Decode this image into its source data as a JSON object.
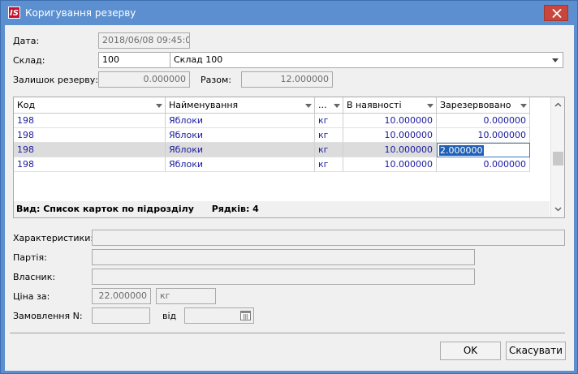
{
  "window": {
    "logo": "IS",
    "title": "Коригування резерву"
  },
  "form": {
    "date_label": "Дата:",
    "date_value": "2018/06/08 09:45:04",
    "warehouse_label": "Склад:",
    "warehouse_code": "100",
    "warehouse_name": "Склад 100",
    "reserve_balance_label": "Залишок резерву:",
    "reserve_balance_value": "0.000000",
    "total_label": "Разом:",
    "total_value": "12.000000"
  },
  "grid": {
    "columns": [
      "Код",
      "Найменування",
      "...",
      "В наявності",
      "Зарезервовано"
    ],
    "rows": [
      {
        "code": "198",
        "name": "Яблоки",
        "unit": "кг",
        "available": "10.000000",
        "reserved": "0.000000"
      },
      {
        "code": "198",
        "name": "Яблоки",
        "unit": "кг",
        "available": "10.000000",
        "reserved": "10.000000"
      },
      {
        "code": "198",
        "name": "Яблоки",
        "unit": "кг",
        "available": "10.000000",
        "reserved": "2.000000"
      },
      {
        "code": "198",
        "name": "Яблоки",
        "unit": "кг",
        "available": "10.000000",
        "reserved": "0.000000"
      }
    ],
    "footer_view": "Вид: Список карток по підрозділу",
    "footer_rows": "Рядків: 4"
  },
  "details": {
    "characteristics_label": "Характеристики:",
    "characteristics_value": "",
    "batch_label": "Партія:",
    "batch_value": "",
    "owner_label": "Власник:",
    "owner_value": "",
    "price_label": "Ціна за:",
    "price_value": "22.000000",
    "price_unit": "кг",
    "order_label": "Замовлення N:",
    "order_value": "",
    "from_label": "від",
    "from_value": ""
  },
  "buttons": {
    "ok": "OK",
    "cancel": "Скасувати"
  },
  "colors": {
    "titlebar": "#5b8fd0",
    "close": "#c9463d",
    "grid_text": "#1a1aa0",
    "selection": "#1f5fb5"
  }
}
